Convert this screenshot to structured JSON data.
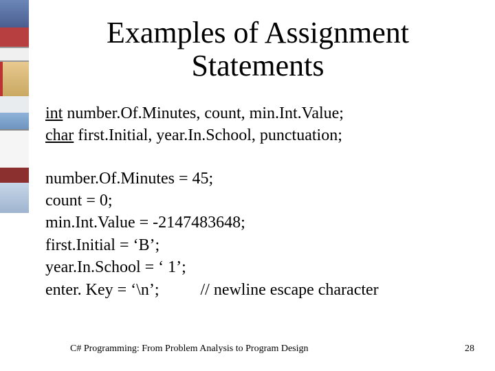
{
  "title": "Examples of Assignment Statements",
  "decl": {
    "kw1": "int",
    "line1_rest": " number.Of.Minutes, count, min.Int.Value;",
    "kw2": "char",
    "line2_rest": " first.Initial, year.In.School, punctuation;"
  },
  "stmts": {
    "s1": "number.Of.Minutes = 45;",
    "s2": "count = 0;",
    "s3": "min.Int.Value = -2147483648;",
    "s4": "first.Initial = ‘B’;",
    "s5": "year.In.School = ‘ 1’;",
    "s6_left": "enter. Key = ‘\\n’;",
    "s6_gap": "          ",
    "s6_comment": "// newline escape character"
  },
  "footer": {
    "source": "C# Programming: From Problem Analysis to Program Design",
    "page": "28"
  }
}
